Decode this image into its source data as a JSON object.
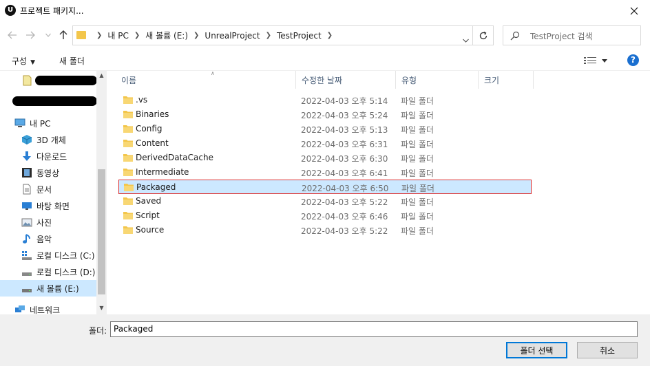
{
  "window": {
    "title": "프로젝트 패키지...",
    "app_icon_letter": "U"
  },
  "address": {
    "crumbs": [
      "내 PC",
      "새 볼륨 (E:)",
      "UnrealProject",
      "TestProject"
    ],
    "search_placeholder": "TestProject 검색"
  },
  "toolbar": {
    "organize": "구성",
    "new_folder": "새 폴더",
    "help": "?"
  },
  "nav": {
    "items": [
      {
        "label": "내 PC",
        "icon": "pc-icon"
      },
      {
        "label": "3D 개체",
        "icon": "3d-objects-icon"
      },
      {
        "label": "다운로드",
        "icon": "download-icon"
      },
      {
        "label": "동영상",
        "icon": "video-icon"
      },
      {
        "label": "문서",
        "icon": "document-icon"
      },
      {
        "label": "바탕 화면",
        "icon": "desktop-icon"
      },
      {
        "label": "사진",
        "icon": "pictures-icon"
      },
      {
        "label": "음악",
        "icon": "music-icon"
      },
      {
        "label": "로컬 디스크 (C:)",
        "icon": "drive-icon"
      },
      {
        "label": "로컬 디스크 (D:)",
        "icon": "drive-icon"
      },
      {
        "label": "새 볼륨 (E:)",
        "icon": "drive-icon"
      },
      {
        "label": "네트워크",
        "icon": "network-icon"
      }
    ]
  },
  "columns": {
    "name": "이름",
    "date": "수정한 날짜",
    "type": "유형",
    "size": "크기"
  },
  "files": [
    {
      "name": ".vs",
      "date": "2022-04-03 오후 5:14",
      "type": "파일 폴더"
    },
    {
      "name": "Binaries",
      "date": "2022-04-03 오후 5:24",
      "type": "파일 폴더"
    },
    {
      "name": "Config",
      "date": "2022-04-03 오후 5:13",
      "type": "파일 폴더"
    },
    {
      "name": "Content",
      "date": "2022-04-03 오후 6:31",
      "type": "파일 폴더"
    },
    {
      "name": "DerivedDataCache",
      "date": "2022-04-03 오후 6:30",
      "type": "파일 폴더"
    },
    {
      "name": "Intermediate",
      "date": "2022-04-03 오후 6:41",
      "type": "파일 폴더"
    },
    {
      "name": "Packaged",
      "date": "2022-04-03 오후 6:50",
      "type": "파일 폴더"
    },
    {
      "name": "Saved",
      "date": "2022-04-03 오후 5:22",
      "type": "파일 폴더"
    },
    {
      "name": "Script",
      "date": "2022-04-03 오후 6:46",
      "type": "파일 폴더"
    },
    {
      "name": "Source",
      "date": "2022-04-03 오후 5:22",
      "type": "파일 폴더"
    }
  ],
  "bottom": {
    "folder_label": "폴더:",
    "folder_value": "Packaged",
    "select_button": "폴더 선택",
    "cancel_button": "취소"
  },
  "colors": {
    "selection": "#cce8ff",
    "highlight_border": "#dd3333",
    "folder": "#f3c64b",
    "accent": "#0078d7"
  }
}
